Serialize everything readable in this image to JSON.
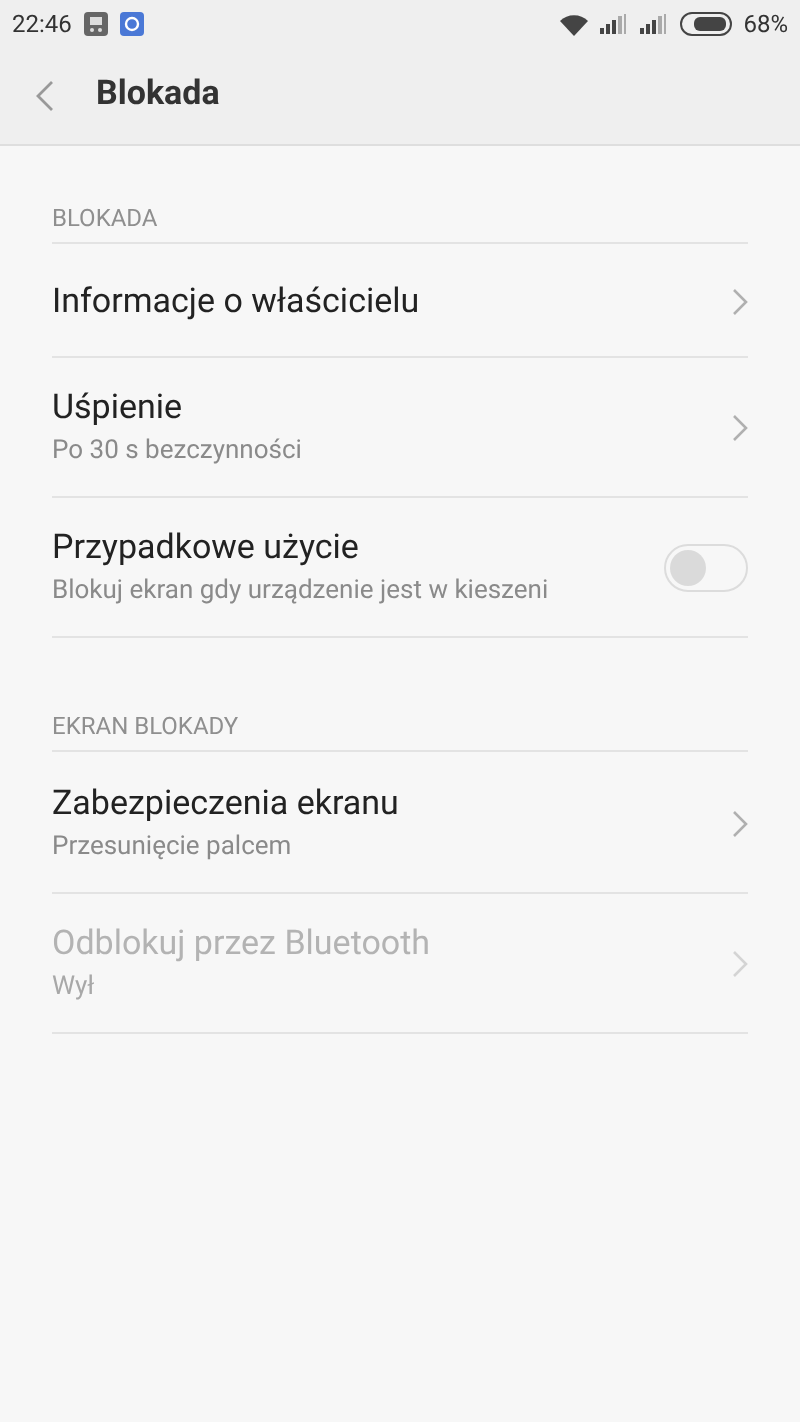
{
  "status_bar": {
    "time": "22:46",
    "battery": "68%"
  },
  "header": {
    "title": "Blokada"
  },
  "sections": [
    {
      "title": "BLOKADA",
      "items": [
        {
          "kind": "link",
          "title": "Informacje o właścicielu",
          "disabled": false
        },
        {
          "kind": "link",
          "title": "Uśpienie",
          "subtitle": "Po 30 s bezczynności",
          "disabled": false
        },
        {
          "kind": "toggle",
          "title": "Przypadkowe użycie",
          "subtitle": "Blokuj ekran gdy urządzenie jest w kieszeni",
          "on": false,
          "disabled": false
        }
      ]
    },
    {
      "title": "EKRAN BLOKADY",
      "items": [
        {
          "kind": "link",
          "title": "Zabezpieczenia ekranu",
          "subtitle": "Przesunięcie palcem",
          "disabled": false
        },
        {
          "kind": "link",
          "title": "Odblokuj przez Bluetooth",
          "subtitle": "Wył",
          "disabled": true
        }
      ]
    }
  ]
}
